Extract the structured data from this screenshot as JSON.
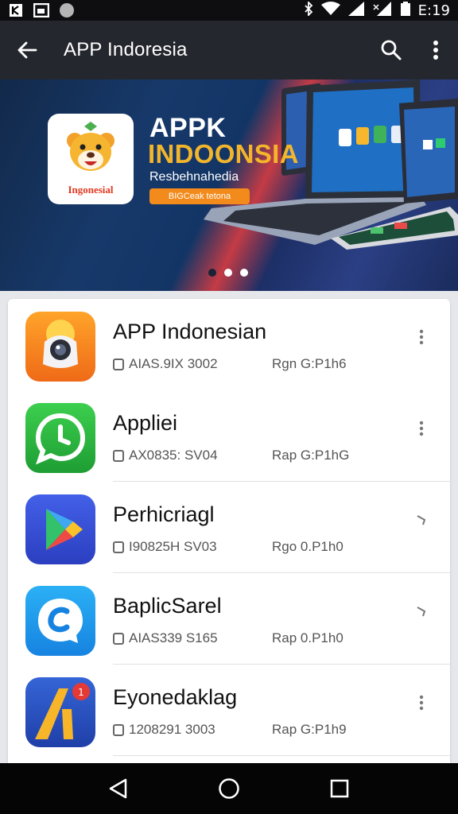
{
  "status_bar": {
    "time": "E:19"
  },
  "app_bar": {
    "title": "APP Indoresia"
  },
  "banner": {
    "logo_text": "Ingonesial",
    "headline_1": "APPK",
    "headline_2": "INDOONSIA",
    "subtitle": "Resbehnahedia",
    "cta": "BIGCeak tetona",
    "slides_count": 3,
    "active_slide": 2
  },
  "apps": [
    {
      "name": "APP Indonesian",
      "size": "AIAS.9IX 3002",
      "rating": "Rgn G:P1h6",
      "action": "more-vert"
    },
    {
      "name": "Appliei",
      "size": "AX0835: SV04",
      "rating": "Rap G:P1hG",
      "action": "more-vert"
    },
    {
      "name": "Perhicriagl",
      "size": "I90825H SV03",
      "rating": "Rgo 0.P1h0",
      "action": "chevron"
    },
    {
      "name": "BaplicSarel",
      "size": "AIAS339 S165",
      "rating": "Rap 0.P1h0",
      "action": "chevron"
    },
    {
      "name": "Eyonedaklag",
      "size": "1208291 3003",
      "rating": "Rap G:P1h9",
      "action": "more-vert"
    }
  ],
  "colors": {
    "app_bar": "#25272e",
    "banner_accent": "#f2b52b",
    "cta": "#f28b1c",
    "icon_1": "#f07a1a",
    "icon_2": "#25b43c",
    "icon_3": "#3a4fd8",
    "icon_4": "#1e9bef",
    "icon_5": "#2b59c9"
  }
}
